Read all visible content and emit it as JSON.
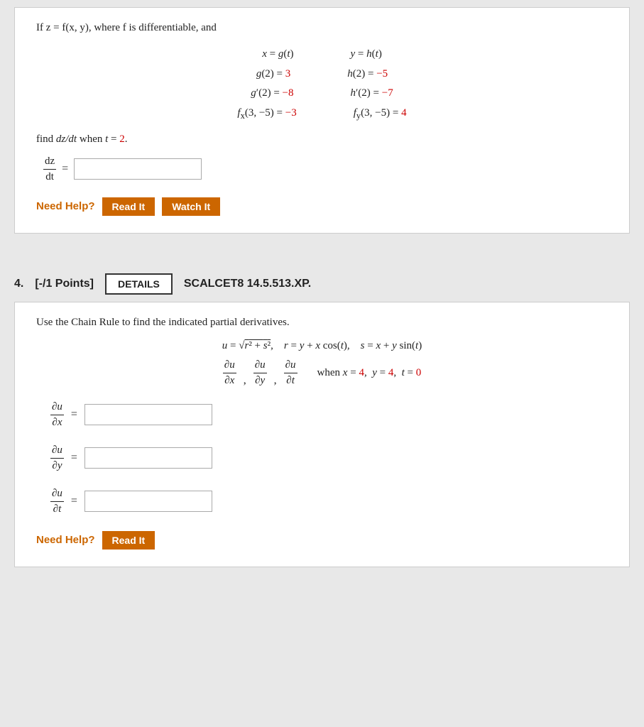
{
  "problem3": {
    "intro": "If z = f(x, y), where f is differentiable, and",
    "given_left_1": "x = g(t)",
    "given_right_1": "y = h(t)",
    "given_left_2": "g(2) = 3",
    "given_right_2": "h(2) = −5",
    "given_left_3": "g′(2) = −8",
    "given_right_3": "h′(2) = −7",
    "given_left_4": "fₓ(3, −5) = −3",
    "given_right_4": "fy(3, −5) = 4",
    "find_text": "find dz/dt when t = 2.",
    "dz_num": "dz",
    "dz_den": "dt",
    "equals": "=",
    "need_help": "Need Help?",
    "read_it": "Read It",
    "watch_it": "Watch It"
  },
  "problem4": {
    "number": "4.",
    "points": "[-/1 Points]",
    "details_label": "DETAILS",
    "problem_id": "SCALCET8 14.5.513.XP.",
    "intro": "Use the Chain Rule to find the indicated partial derivatives.",
    "equation": "u = √(r² + s²),   r = y + x cos(t),   s = x + y sin(t)",
    "partial_label": "∂u/∂x, ∂u/∂y, ∂u/∂t",
    "when_text": "when x = 4,  y = 4,  t = 0",
    "answer1_num": "∂u",
    "answer1_den": "∂x",
    "answer2_num": "∂u",
    "answer2_den": "∂y",
    "answer3_num": "∂u",
    "answer3_den": "∂t",
    "equals": "=",
    "need_help": "Need Help?",
    "read_it": "Read It"
  }
}
